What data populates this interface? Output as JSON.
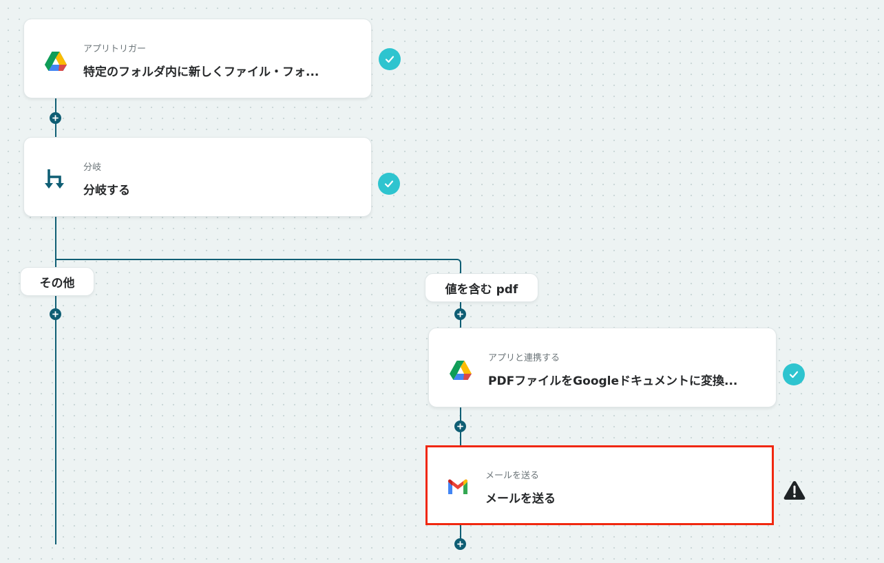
{
  "flow": {
    "trigger": {
      "subtitle": "アプリトリガー",
      "title": "特定のフォルダ内に新しくファイル・フォ...",
      "icon": "google-drive-icon",
      "status": "completed"
    },
    "branch": {
      "subtitle": "分岐",
      "title": "分岐する",
      "icon": "branch-icon",
      "status": "completed"
    },
    "branch_labels": {
      "other": "その他",
      "contains": "値を含む pdf"
    },
    "convert": {
      "subtitle": "アプリと連携する",
      "title": "PDFファイルをGoogleドキュメントに変換...",
      "icon": "google-drive-icon",
      "status": "completed"
    },
    "send_mail": {
      "subtitle": "メールを送る",
      "title": "メールを送る",
      "icon": "gmail-icon",
      "status": "warning"
    }
  },
  "colors": {
    "connector": "#0f5e74",
    "check": "#2ec4cf",
    "highlight_border": "#f0270f",
    "background": "#edf3f3"
  }
}
